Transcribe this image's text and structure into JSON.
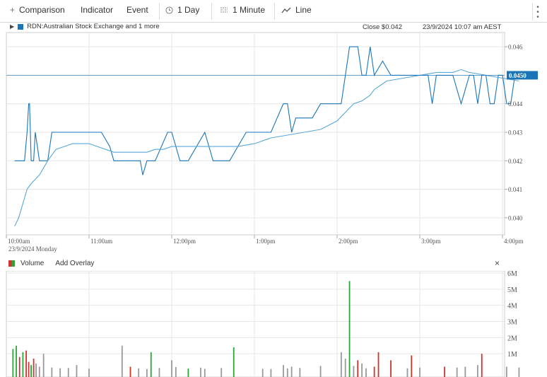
{
  "toolbar": {
    "comparison": "Comparison",
    "indicator": "Indicator",
    "event": "Event",
    "period": "1 Day",
    "interval": "1 Minute",
    "chart_type": "Line",
    "plus_icon": "plus-icon",
    "clock_icon": "clock-icon",
    "interval_icon": "candle-interval-icon",
    "line_icon": "line-chart-icon",
    "menu_icon": "vertical-dots-icon"
  },
  "legend": {
    "label": "RDN:Australian Stock Exchange and 1 more",
    "close": "Close $0.042",
    "datetime": "23/9/2024 10:07 am AEST",
    "series_color": "#1a75b8"
  },
  "price_axis": {
    "ticks": [
      "0.046",
      "0.044",
      "0.043",
      "0.042",
      "0.041",
      "0.040"
    ],
    "current_label": "0.0450"
  },
  "time_axis": {
    "ticks": [
      "10:00am",
      "11:00am",
      "12:00pm",
      "1:00pm",
      "2:00pm",
      "3:00pm",
      "4:00pm"
    ],
    "date_label": "23/9/2024 Monday"
  },
  "volume_panel": {
    "title": "Volume",
    "add_overlay": "Add Overlay",
    "close": "×",
    "ticks": [
      "6M",
      "5M",
      "4M",
      "3M",
      "2M",
      "1M"
    ]
  },
  "chart_data": [
    {
      "type": "line",
      "title": "",
      "x_unit": "hours since 10:00am",
      "xlim": [
        0,
        6
      ],
      "ylim": [
        0.0394,
        0.0465
      ],
      "series": [
        {
          "name": "RDN:Australian Stock Exchange",
          "color": "#1a75b8",
          "x": [
            0.1,
            0.22,
            0.25,
            0.27,
            0.28,
            0.3,
            0.33,
            0.35,
            0.4,
            0.5,
            0.55,
            0.58,
            0.62,
            0.85,
            1.0,
            1.15,
            1.25,
            1.3,
            1.4,
            1.5,
            1.6,
            1.62,
            1.65,
            1.7,
            1.75,
            1.8,
            1.95,
            2.0,
            2.1,
            2.2,
            2.4,
            2.5,
            2.7,
            2.9,
            3.0,
            3.2,
            3.35,
            3.4,
            3.45,
            3.5,
            3.7,
            3.8,
            4.0,
            4.05,
            4.1,
            4.15,
            4.25,
            4.3,
            4.35,
            4.4,
            4.45,
            4.55,
            4.65,
            4.75,
            4.9,
            5.1,
            5.15,
            5.2,
            5.4,
            5.5,
            5.6,
            5.65,
            5.7,
            5.75,
            5.8,
            5.85,
            5.9,
            5.95,
            6.0,
            6.05,
            6.1,
            6.15,
            6.2,
            6.25
          ],
          "values": [
            0.042,
            0.042,
            0.043,
            0.044,
            0.044,
            0.042,
            0.042,
            0.043,
            0.042,
            0.042,
            0.043,
            0.043,
            0.043,
            0.043,
            0.043,
            0.043,
            0.0425,
            0.042,
            0.042,
            0.042,
            0.042,
            0.042,
            0.0415,
            0.042,
            0.042,
            0.042,
            0.043,
            0.043,
            0.042,
            0.042,
            0.043,
            0.042,
            0.042,
            0.043,
            0.043,
            0.043,
            0.044,
            0.044,
            0.043,
            0.0435,
            0.0435,
            0.044,
            0.044,
            0.044,
            0.045,
            0.046,
            0.046,
            0.045,
            0.045,
            0.046,
            0.045,
            0.0455,
            0.045,
            0.045,
            0.045,
            0.045,
            0.044,
            0.045,
            0.045,
            0.044,
            0.045,
            0.045,
            0.044,
            0.045,
            0.045,
            0.044,
            0.044,
            0.045,
            0.045,
            0.044,
            0.044,
            0.045,
            0.045,
            0.045
          ]
        },
        {
          "name": "",
          "color": "#5aa8d8",
          "x": [
            0.1,
            0.15,
            0.2,
            0.25,
            0.3,
            0.4,
            0.5,
            0.6,
            0.7,
            0.8,
            1.0,
            1.1,
            1.2,
            1.3,
            1.4,
            1.5,
            1.6,
            1.7,
            1.8,
            1.9,
            2.0,
            2.1,
            2.2,
            2.4,
            2.6,
            2.8,
            3.0,
            3.2,
            3.4,
            3.6,
            3.8,
            4.0,
            4.2,
            4.3,
            4.4,
            4.45,
            4.5,
            4.6,
            4.8,
            5.0,
            5.2,
            5.4,
            5.5,
            5.6,
            5.8,
            6.0,
            6.2
          ],
          "values": [
            0.0397,
            0.04,
            0.0405,
            0.041,
            0.0412,
            0.0415,
            0.042,
            0.0424,
            0.0425,
            0.0426,
            0.0426,
            0.0425,
            0.0424,
            0.0423,
            0.0423,
            0.0423,
            0.0423,
            0.0423,
            0.0424,
            0.0424,
            0.0425,
            0.0425,
            0.0425,
            0.0425,
            0.0425,
            0.0425,
            0.0426,
            0.0428,
            0.0429,
            0.043,
            0.0431,
            0.0434,
            0.044,
            0.0441,
            0.0443,
            0.0445,
            0.0446,
            0.0448,
            0.0449,
            0.045,
            0.0451,
            0.0451,
            0.0452,
            0.0451,
            0.045,
            0.0449,
            0.0448
          ]
        }
      ]
    },
    {
      "type": "bar",
      "title": "Volume",
      "ylim": [
        0,
        6000000
      ],
      "series": [
        {
          "name": "Volume",
          "x": [
            0.08,
            0.12,
            0.16,
            0.2,
            0.24,
            0.27,
            0.3,
            0.33,
            0.36,
            0.4,
            0.45,
            0.55,
            0.65,
            0.75,
            0.85,
            1.0,
            1.4,
            1.5,
            1.6,
            1.7,
            1.75,
            1.85,
            2.0,
            2.05,
            2.2,
            2.35,
            2.4,
            2.6,
            2.75,
            3.1,
            3.2,
            3.35,
            3.4,
            3.45,
            3.55,
            3.8,
            4.05,
            4.1,
            4.15,
            4.2,
            4.25,
            4.3,
            4.35,
            4.45,
            4.5,
            4.65,
            4.85,
            4.9,
            5.0,
            5.3,
            5.45,
            5.55,
            5.7,
            5.75,
            6.05,
            6.2
          ],
          "values": [
            1300000,
            1500000,
            800000,
            1100000,
            1200000,
            500000,
            300000,
            700000,
            400000,
            200000,
            1000000,
            150000,
            100000,
            120000,
            300000,
            80000,
            1500000,
            200000,
            100000,
            60000,
            1100000,
            120000,
            600000,
            180000,
            80000,
            140000,
            70000,
            120000,
            1400000,
            70000,
            60000,
            300000,
            90000,
            200000,
            120000,
            250000,
            1100000,
            700000,
            5500000,
            250000,
            600000,
            400000,
            100000,
            200000,
            1100000,
            600000,
            100000,
            900000,
            150000,
            200000,
            150000,
            200000,
            300000,
            1000000,
            200000,
            150000
          ],
          "colors": [
            "#2aa53a",
            "#2aa53a",
            "#d0342c",
            "#2aa53a",
            "#d0342c",
            "#d0342c",
            "#2aa53a",
            "#d0342c",
            "#999999",
            "#999999",
            "#999999",
            "#999999",
            "#999999",
            "#999999",
            "#999999",
            "#999999",
            "#999999",
            "#d0342c",
            "#999999",
            "#999999",
            "#2aa53a",
            "#999999",
            "#999999",
            "#999999",
            "#2aa53a",
            "#999999",
            "#999999",
            "#999999",
            "#2aa53a",
            "#999999",
            "#999999",
            "#999999",
            "#999999",
            "#999999",
            "#999999",
            "#999999",
            "#999999",
            "#999999",
            "#2aa53a",
            "#999999",
            "#d0342c",
            "#999999",
            "#999999",
            "#d0342c",
            "#d0342c",
            "#d0342c",
            "#999999",
            "#d0342c",
            "#999999",
            "#d0342c",
            "#999999",
            "#999999",
            "#999999",
            "#d0342c",
            "#999999",
            "#999999"
          ]
        }
      ]
    }
  ]
}
